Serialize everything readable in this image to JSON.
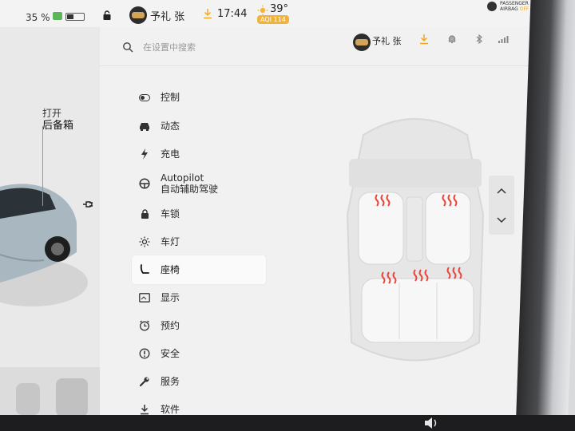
{
  "status_bar": {
    "battery_percent": "35 %",
    "user_name": "予礼 张",
    "time": "17:44",
    "temperature": "39°",
    "aqi": "AQI 114",
    "airbag_line1": "PASSENGER",
    "airbag_line2": "AIRBAG",
    "airbag_state": "OFF"
  },
  "car_view": {
    "trunk_action": "打开",
    "trunk_label": "后备箱"
  },
  "settings": {
    "search_placeholder": "在设置中搜索",
    "user_name": "予礼 张",
    "menu": [
      {
        "label": "控制",
        "icon": "toggle-icon"
      },
      {
        "label": "动态",
        "icon": "car-icon"
      },
      {
        "label": "充电",
        "icon": "lightning-icon"
      },
      {
        "label": "Autopilot",
        "sublabel": "自动辅助驾驶",
        "icon": "steering-wheel-icon"
      },
      {
        "label": "车锁",
        "icon": "lock-icon"
      },
      {
        "label": "车灯",
        "icon": "light-icon"
      },
      {
        "label": "座椅",
        "icon": "seat-icon",
        "active": true
      },
      {
        "label": "显示",
        "icon": "display-icon"
      },
      {
        "label": "预约",
        "icon": "clock-icon"
      },
      {
        "label": "安全",
        "icon": "info-icon"
      },
      {
        "label": "服务",
        "icon": "wrench-icon"
      },
      {
        "label": "软件",
        "icon": "download-icon"
      }
    ]
  },
  "seats": {
    "heated": [
      "driver",
      "passenger",
      "rear-left",
      "rear-center",
      "rear-right"
    ],
    "heat_color": "#e8463b"
  },
  "colors": {
    "accent_orange": "#f2a91e",
    "battery_green": "#5bb55a"
  }
}
